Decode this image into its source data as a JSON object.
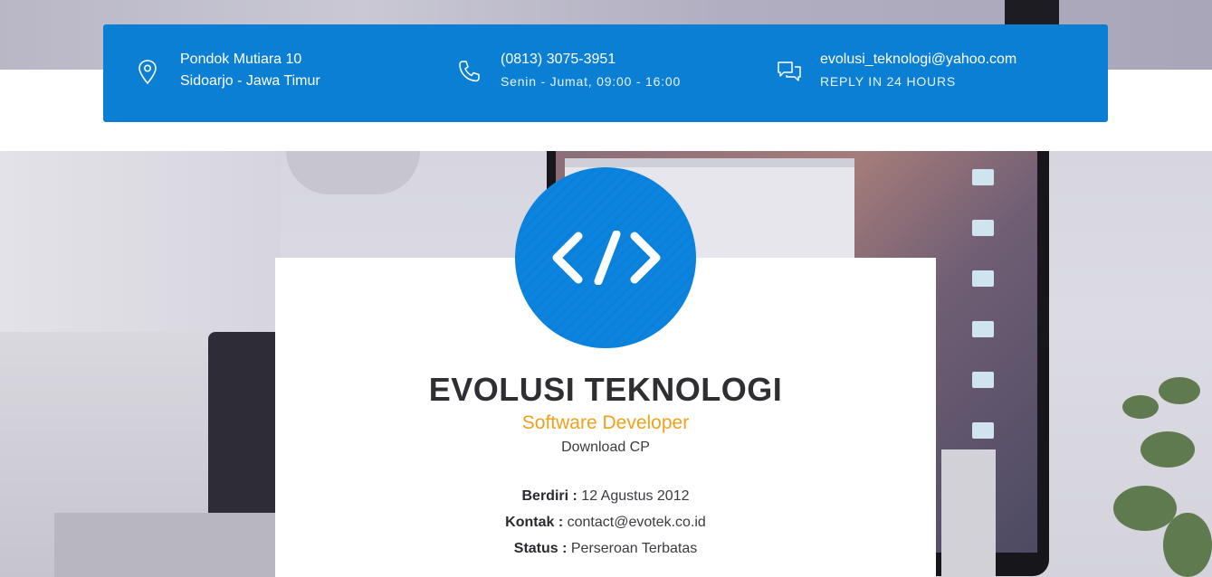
{
  "contact": {
    "address": {
      "icon": "map-pin-icon",
      "line1": "Pondok Mutiara 10",
      "line2": "Sidoarjo - Jawa Timur"
    },
    "phone": {
      "icon": "phone-icon",
      "line1": "(0813) 3075-3951",
      "line2": "Senin - Jumat, 09:00 - 16:00"
    },
    "email": {
      "icon": "chat-bubbles-icon",
      "line1": "evolusi_teknologi@yahoo.com",
      "line2": "REPLY IN 24 HOURS"
    }
  },
  "company": {
    "logo_icon": "code-brackets-icon",
    "name": "EVOLUSI TEKNOLOGI",
    "tagline": "Software Developer",
    "download_label": "Download CP"
  },
  "info": [
    {
      "label": "Berdiri :",
      "value": " 12 Agustus 2012"
    },
    {
      "label": "Kontak :",
      "value": " contact@evotek.co.id"
    },
    {
      "label": "Status :",
      "value": " Perseroan Terbatas"
    }
  ],
  "colors": {
    "primary_blue": "#0b7fd4",
    "accent_orange": "#f0a11c",
    "text_dark": "#2f2f33"
  }
}
